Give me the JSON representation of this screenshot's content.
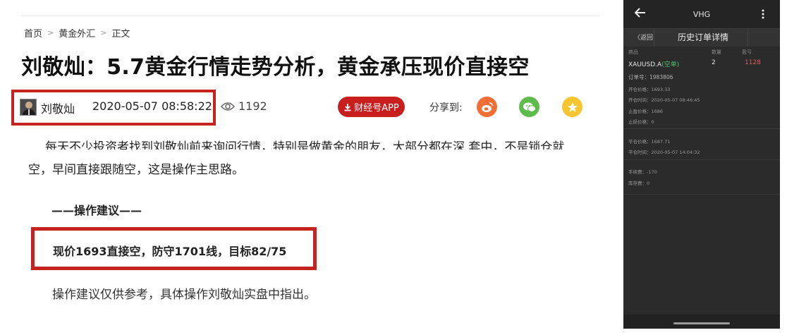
{
  "breadcrumb": {
    "home": "首页",
    "category": "黄金外汇",
    "current": "正文",
    "separator": ">"
  },
  "article": {
    "title": "刘敬灿：5.7黄金行情走势分析，黄金承压现价直接空",
    "author": "刘敬灿",
    "datetime": "2020-05-07 08:58:22",
    "views": "1192",
    "app_button": "财经号APP",
    "share_label": "分享到:",
    "para1_clipped": "每天不少投资者找到刘敬灿前来询问行情，特别是做黄金的朋友，大部分都在深 套中，不是锁仓就",
    "para2": "空，早间直接跟随空，这是操作主思路。",
    "advice_heading": "——操作建议——",
    "advice": "现价1693直接空，防守1701线，目标82/75",
    "disclaimer": "操作建议仅供参考，具体操作刘敬灿实盘中指出。"
  },
  "phone": {
    "app_title": "VHG",
    "back_label": "〈返回",
    "screen_title": "历史订单详情",
    "col_symbol": "商品",
    "col_qty": "数量",
    "col_lot": "盈亏",
    "symbol": "XAUUSD.A",
    "direction": "(空单)",
    "qty": "2",
    "profit": "1128",
    "order_no": "订单号：1983806",
    "open_price": "开仓价格：1693.33",
    "open_time": "开仓时间：2020-05-07 08:46:45",
    "take_profit": "止盈价格：1686",
    "stop_loss": "止损价格：0",
    "close_price": "平仓价格：1687.71",
    "close_time": "平仓时间：2020-05-07 14:04:32",
    "commission": "手续费：-170",
    "swap": "库存费：0"
  },
  "colors": {
    "highlight_red": "#c4231f",
    "app_red": "#c81e1e",
    "weibo": "#f36e35",
    "wechat": "#5fbb4c",
    "favorite": "#f7c531",
    "profit_red": "#e05a5a",
    "short_green": "#4fc06b"
  },
  "icons": [
    "eye-icon",
    "download-icon",
    "weibo-icon",
    "wechat-icon",
    "star-icon",
    "back-arrow-icon",
    "more-vertical-icon"
  ]
}
